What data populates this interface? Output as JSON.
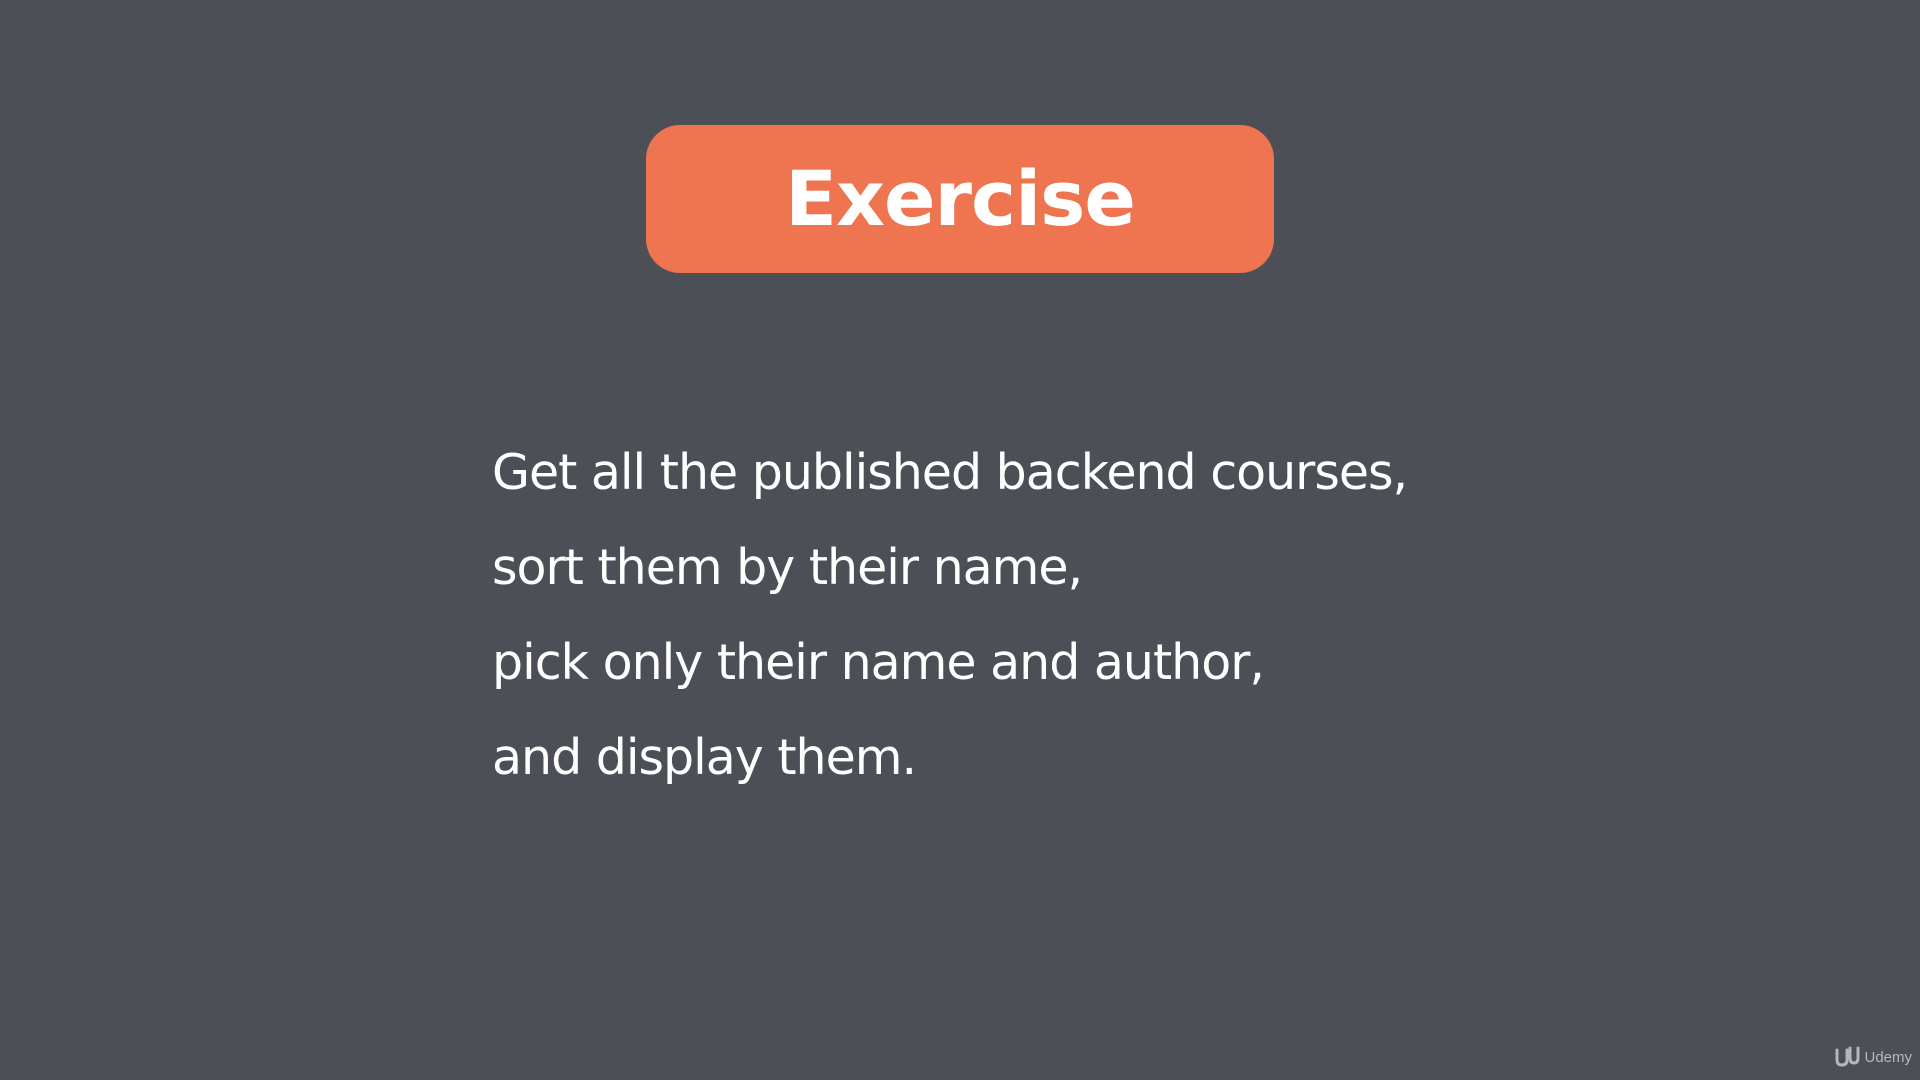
{
  "slide": {
    "title": "Exercise",
    "lines": [
      "Get all the published backend courses,",
      "sort them by their name,",
      "pick only their name and author,",
      "and display them."
    ]
  },
  "watermark": {
    "text": "Udemy",
    "icon": "udemy-logo-icon"
  },
  "colors": {
    "background": "#4d4f57",
    "accent": "#ee7550",
    "text": "#ffffff"
  }
}
